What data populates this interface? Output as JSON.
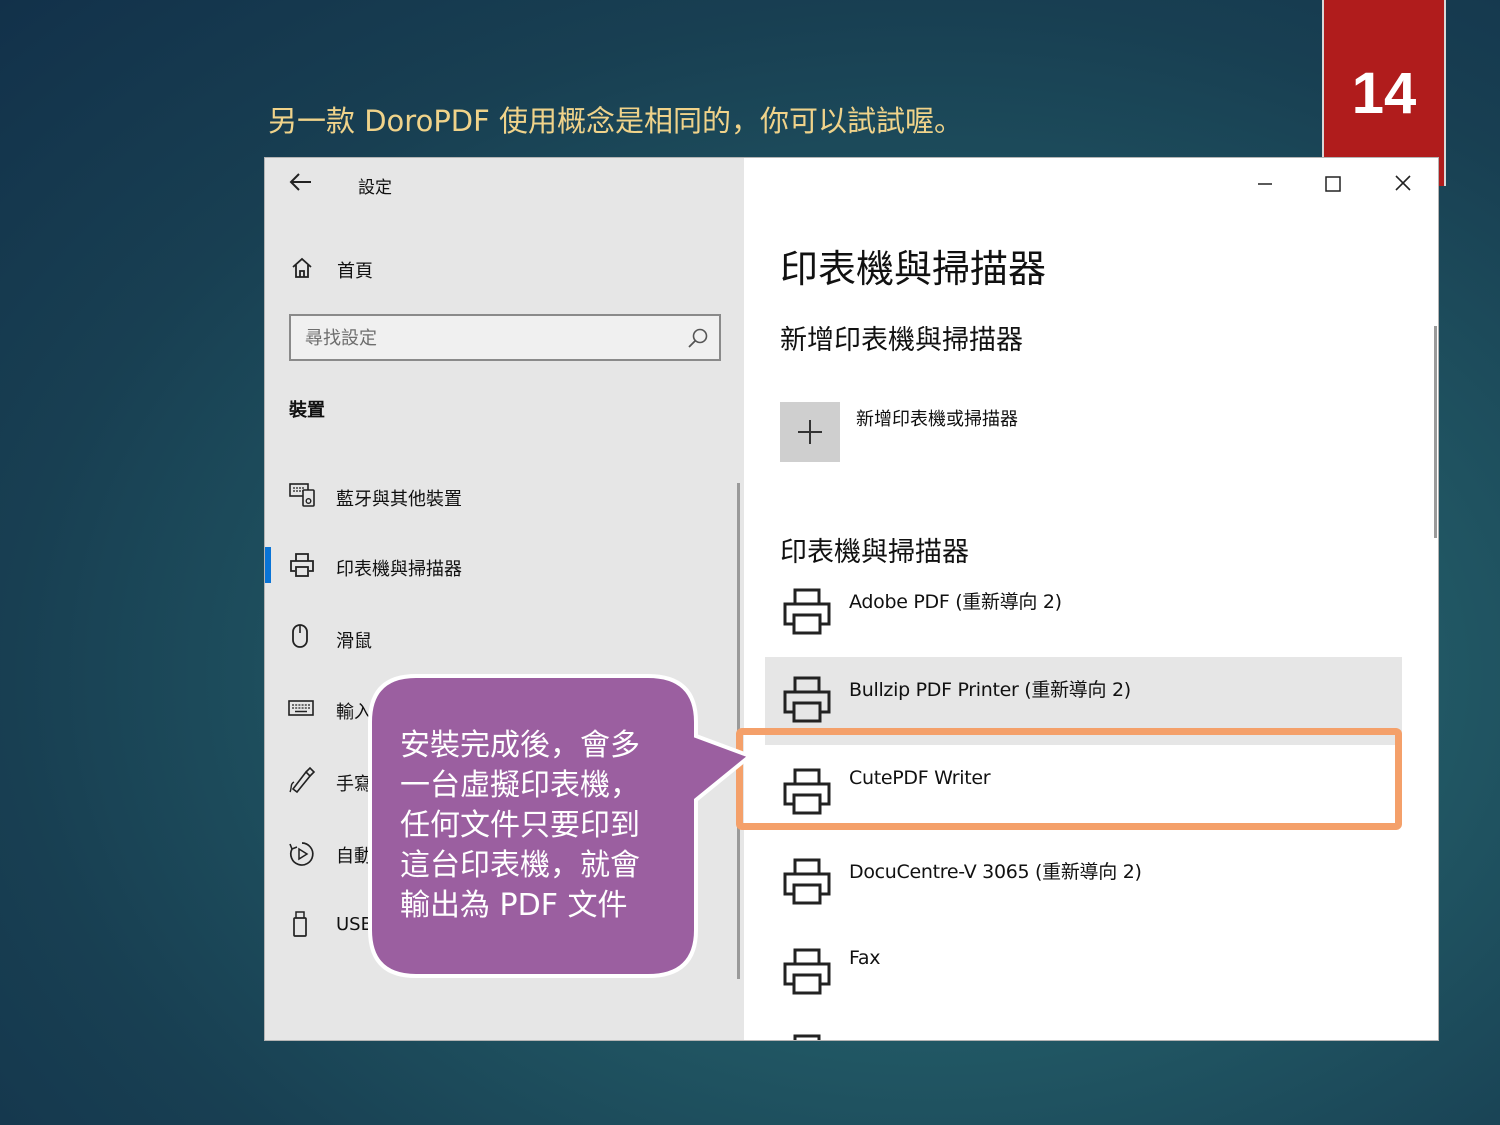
{
  "slide": {
    "number": "14",
    "title": "另一款 DoroPDF 使用概念是相同的，你可以試試喔。"
  },
  "window": {
    "app_title": "設定",
    "sidebar": {
      "home_label": "首頁",
      "search_placeholder": "尋找設定",
      "section_heading": "裝置",
      "items": [
        {
          "label": "藍牙與其他裝置",
          "icon": "bluetooth-devices-icon"
        },
        {
          "label": "印表機與掃描器",
          "icon": "printer-icon",
          "active": true
        },
        {
          "label": "滑鼠",
          "icon": "mouse-icon"
        },
        {
          "label": "輸入",
          "icon": "keyboard-icon"
        },
        {
          "label": "手寫筆",
          "icon": "pen-icon"
        },
        {
          "label": "自動播放",
          "icon": "autoplay-icon"
        },
        {
          "label": "USB",
          "icon": "usb-icon"
        }
      ]
    },
    "main": {
      "page_title": "印表機與掃描器",
      "add_section_title": "新增印表機與掃描器",
      "add_button_label": "新增印表機或掃描器",
      "list_section_title": "印表機與掃描器",
      "printers": [
        {
          "name": "Adobe PDF (重新導向 2)"
        },
        {
          "name": "Bullzip PDF Printer (重新導向 2)",
          "state": "hover"
        },
        {
          "name": "CutePDF Writer",
          "state": "highlighted"
        },
        {
          "name": "DocuCentre-V 3065 (重新導向 2)"
        },
        {
          "name": "Fax"
        }
      ]
    }
  },
  "callout": {
    "lines": [
      "安裝完成後，會多",
      "一台虛擬印表機，",
      "任何文件只要印到",
      "這台印表機，就會",
      "輸出為 PDF 文件"
    ],
    "fill_color": "#9b5fa0",
    "highlight_color": "#f4a06a"
  },
  "colors": {
    "slide_number_bg": "#b01c1c",
    "title_text": "#f0d38a",
    "accent": "#0a74d6"
  }
}
